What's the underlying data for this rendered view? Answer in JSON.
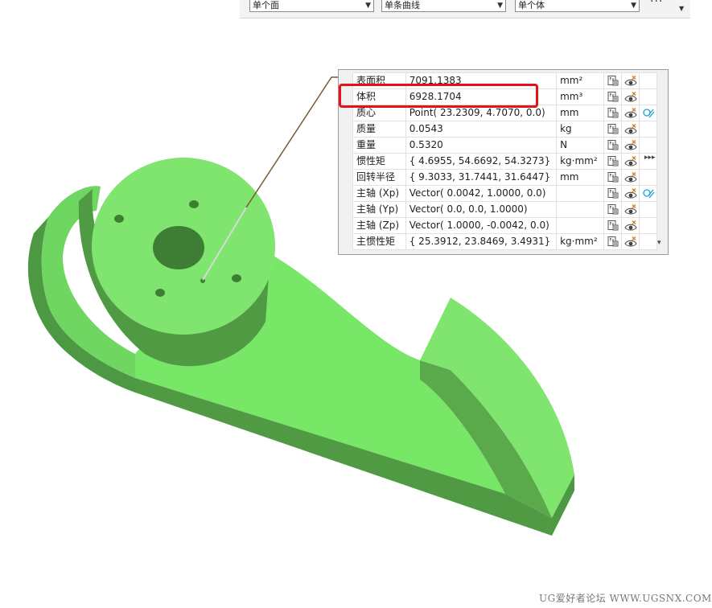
{
  "toolbar": {
    "filters": [
      "单个面",
      "单条曲线",
      "单个体"
    ],
    "more_label": "···",
    "dropdown_arrow": "▼"
  },
  "panel": {
    "rows": [
      {
        "name": "表面积",
        "value": "7091.1383",
        "unit": "mm²",
        "has_link": false
      },
      {
        "name": "体积",
        "value": "6928.1704",
        "unit": "mm³",
        "has_link": false
      },
      {
        "name": "质心",
        "value": "Point( 23.2309, 4.7070, 0.0)",
        "unit": "mm",
        "has_link": true
      },
      {
        "name": "质量",
        "value": "0.0543",
        "unit": "kg",
        "has_link": false
      },
      {
        "name": "重量",
        "value": "0.5320",
        "unit": "N",
        "has_link": false
      },
      {
        "name": "惯性矩",
        "value": "{ 4.6955, 54.6692, 54.3273}",
        "unit": "kg·mm²",
        "has_link": false
      },
      {
        "name": "回转半径",
        "value": "{ 9.3033, 31.7441, 31.6447}",
        "unit": "mm",
        "has_link": false
      },
      {
        "name": "主轴 (Xp)",
        "value": "Vector( 0.0042, 1.0000, 0.0)",
        "unit": "",
        "has_link": true
      },
      {
        "name": "主轴 (Yp)",
        "value": "Vector( 0.0, 0.0, 1.0000)",
        "unit": "",
        "has_link": false
      },
      {
        "name": "主轴 (Zp)",
        "value": "Vector( 1.0000, -0.0042, 0.0)",
        "unit": "",
        "has_link": false
      },
      {
        "name": "主惯性矩",
        "value": "{ 25.3912, 23.8469, 3.4931}",
        "unit": "kg·mm²",
        "has_link": false
      }
    ],
    "icons": [
      "export-doc-icon",
      "visibility-eye-icon",
      "link-icon"
    ],
    "side_arrows": "▸▸▸",
    "scroll_down": "▾"
  },
  "highlight_color": "#e5121b",
  "model_colors": {
    "top": "#7fe56f",
    "side": "#4f9a43",
    "mid": "#67c659"
  },
  "watermark": "UG爱好者论坛 WWW.UGSNX.COM"
}
